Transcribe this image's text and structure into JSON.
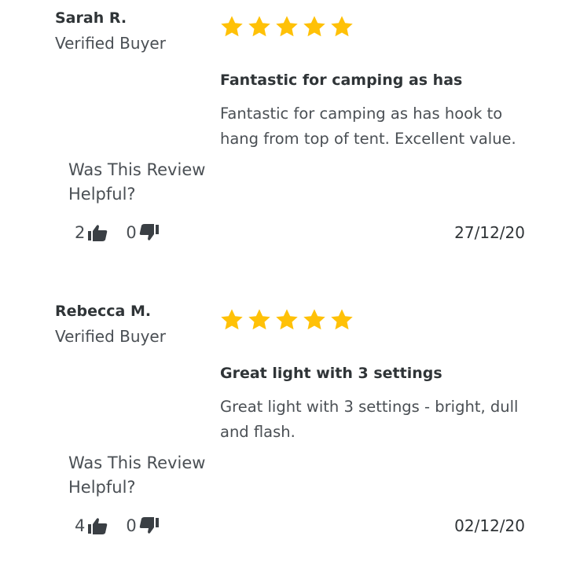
{
  "colors": {
    "star": "#FFC107",
    "text_dark": "#2f3437",
    "text_muted": "#4a4f54"
  },
  "reviews": [
    {
      "name": "Sarah R.",
      "badge": "Verified Buyer",
      "rating": 5,
      "title": "Fantastic for camping as has",
      "body": "Fantastic for camping as has hook to hang from top of tent. Excellent value.",
      "helpful_prompt": "Was This Review Helpful?",
      "helpful_up": "2",
      "helpful_down": "0",
      "date": "27/12/20",
      "icons": {
        "up": "thumbs-up-icon",
        "down": "thumbs-down-icon",
        "star": "star-icon"
      }
    },
    {
      "name": "Rebecca M.",
      "badge": "Verified Buyer",
      "rating": 5,
      "title": "Great light with 3 settings",
      "body": "Great light with 3 settings - bright, dull and flash.",
      "helpful_prompt": "Was This Review Helpful?",
      "helpful_up": "4",
      "helpful_down": "0",
      "date": "02/12/20",
      "icons": {
        "up": "thumbs-up-icon",
        "down": "thumbs-down-icon",
        "star": "star-icon"
      }
    }
  ]
}
